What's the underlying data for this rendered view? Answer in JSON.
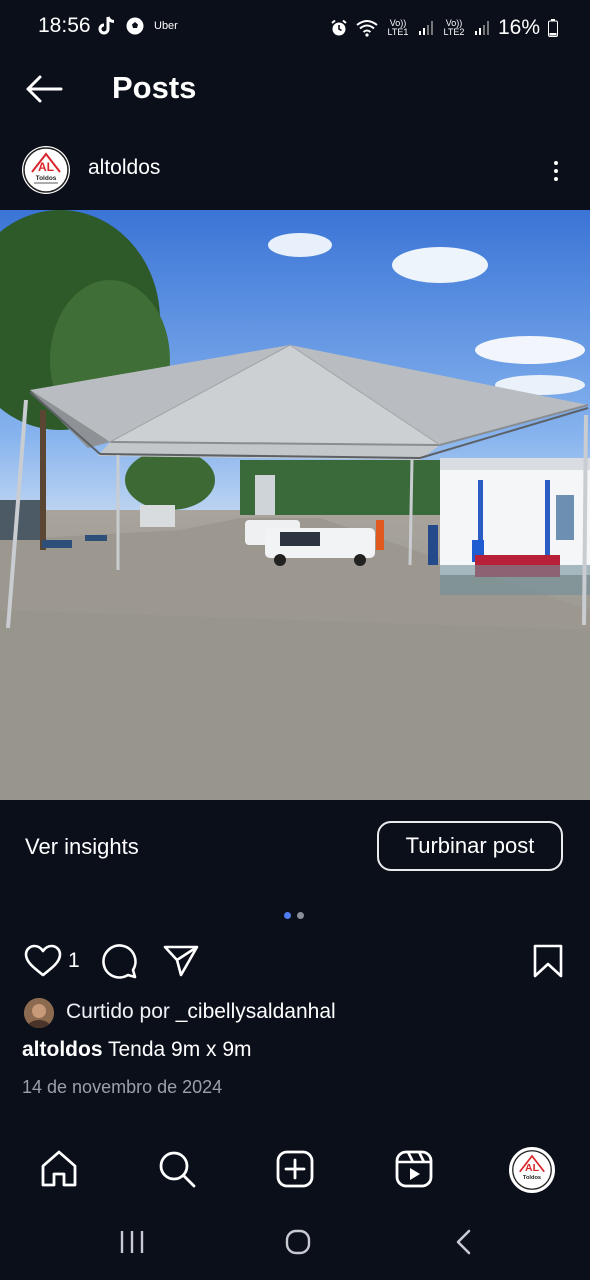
{
  "status_bar": {
    "time": "18:56",
    "app_icons": [
      "tiktok-icon",
      "soccer-ball-icon",
      "uber-label"
    ],
    "uber_label": "Uber",
    "net1": "Vo)) LTE1",
    "net2": "Vo)) LTE2",
    "battery": "16%"
  },
  "header": {
    "title": "Posts"
  },
  "post": {
    "username": "altoldos",
    "avatar_text": "AL",
    "avatar_subtext": "Toldos",
    "insights_label": "Ver insights",
    "boost_label": "Turbinar post",
    "carousel": {
      "count": 2,
      "active_index": 0
    },
    "likes_count": "1",
    "liked_by_prefix": "Curtido por ",
    "liked_by_user": "_cibellysaldanhal",
    "caption_user": "altoldos",
    "caption_text": " Tenda 9m x 9m",
    "date": "14 de novembro de 2024"
  },
  "bottom_nav": {
    "items": [
      "home-icon",
      "search-icon",
      "create-icon",
      "reels-icon",
      "profile-avatar"
    ]
  },
  "colors": {
    "background": "#0b0f1a",
    "text": "#f1f3f6",
    "muted": "#9aa0aa",
    "accent_dot": "#4f7df0",
    "logo_red": "#d8262b"
  }
}
